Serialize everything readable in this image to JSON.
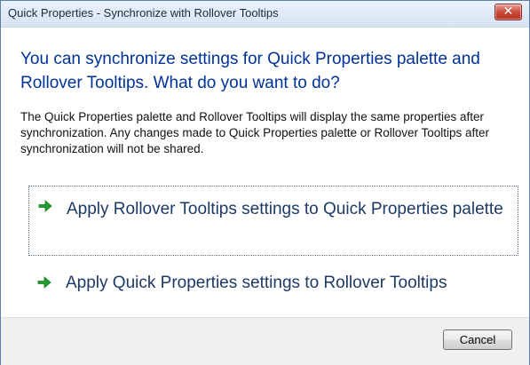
{
  "window": {
    "title": "Quick Properties - Synchronize with Rollover Tooltips",
    "close_icon": "close-icon"
  },
  "main": {
    "instruction": "You can synchronize settings for Quick Properties palette and Rollover Tooltips. What do you want to do?",
    "description": "The Quick Properties palette and Rollover Tooltips will display the same properties after synchronization. Any changes made to Quick Properties palette or Rollover Tooltips after synchronization will not be shared.",
    "commands": [
      {
        "label": "Apply Rollover Tooltips settings to Quick Properties palette",
        "icon": "green-arrow-icon"
      },
      {
        "label": "Apply Quick Properties settings to Rollover Tooltips",
        "icon": "green-arrow-icon"
      }
    ]
  },
  "footer": {
    "cancel_label": "Cancel"
  },
  "colors": {
    "instruction_text": "#003399",
    "arrow": "#1f9d2f",
    "close_button": "#c94b3a"
  }
}
